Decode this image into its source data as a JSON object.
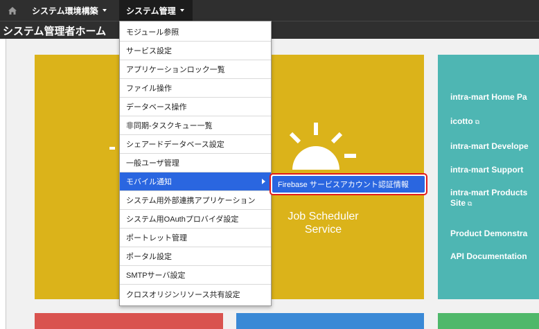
{
  "topbar": {
    "home_icon": "home-icon",
    "menu1_label": "システム環境構築",
    "menu2_label": "システム管理"
  },
  "page": {
    "title": "システム管理者ホーム"
  },
  "dropdown": {
    "items": [
      "モジュール参照",
      "サービス設定",
      "アプリケーションロック一覧",
      "ファイル操作",
      "データベース操作",
      "非同期-タスクキュー一覧",
      "シェアードデータベース設定",
      "一般ユーザ管理",
      "モバイル通知",
      "システム用外部連携アプリケーション",
      "システム用OAuthプロバイダ設定",
      "ポートレット管理",
      "ポータル設定",
      "SMTPサーバ設定",
      "クロスオリジンリソース共有設定"
    ],
    "active_index": 8
  },
  "submenu": {
    "item": "Firebase サービスアカウント認証情報"
  },
  "tiles": {
    "job_scheduler_line1": "Job Scheduler",
    "job_scheduler_line2": "Service",
    "sun_icon": "sun-icon"
  },
  "links": {
    "items": [
      "intra-mart Home Pa",
      "icotto",
      "intra-mart Develope",
      "intra-mart Support",
      "intra-mart Products",
      "Site",
      "Product Demonstra",
      "API Documentation"
    ],
    "external_icon": "external-link-icon"
  },
  "colors": {
    "topbar": "#2f2f2f",
    "gold_tile": "#dbb31a",
    "teal_tile": "#4eb6b3",
    "red_tile": "#d9534f",
    "blue_tile": "#3a89d6",
    "green_tile": "#4fb86a",
    "menu_active": "#2a66e0",
    "highlight_border": "#e21a1a"
  }
}
